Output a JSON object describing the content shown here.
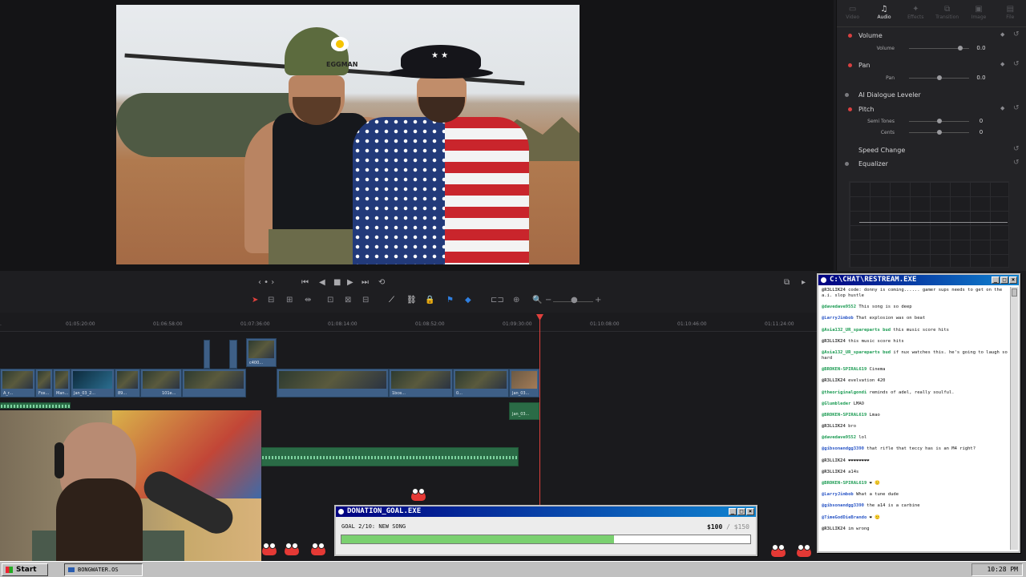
{
  "viewer": {
    "helmet_label": "EGGMAN"
  },
  "inspector": {
    "tabs": [
      {
        "label": "Video",
        "icon": "video-icon"
      },
      {
        "label": "Audio",
        "icon": "music-note-icon"
      },
      {
        "label": "Effects",
        "icon": "effects-icon"
      },
      {
        "label": "Transition",
        "icon": "transition-icon"
      },
      {
        "label": "Image",
        "icon": "image-icon"
      },
      {
        "label": "File",
        "icon": "file-icon"
      }
    ],
    "volume": {
      "title": "Volume",
      "param": "Volume",
      "value": "0.0",
      "level": 0.85
    },
    "pan": {
      "title": "Pan",
      "param": "Pan",
      "value": "0.0",
      "level": 0.5
    },
    "dialogue": {
      "title": "AI Dialogue Leveler"
    },
    "pitch": {
      "title": "Pitch",
      "semi_label": "Semi Tones",
      "semi_value": "0",
      "cents_label": "Cents",
      "cents_value": "0",
      "level": 0.5
    },
    "speed": {
      "title": "Speed Change"
    },
    "eq": {
      "title": "Equalizer"
    }
  },
  "timeline": {
    "ticks": [
      "01:05:20:00",
      "01:06:58:00",
      "01:07:36:00",
      "01:08:14:00",
      "01:08:52:00",
      "01:09:30:00",
      "01:10:08:00",
      "01:10:46:00",
      "01:11:24:00"
    ],
    "clip_labels": [
      "A_r...",
      "Fox...",
      "Man...",
      "Jan_03_2...",
      "89...",
      "101e...",
      "c400...",
      "1bce...",
      "0...",
      "Jan_03...",
      "Jan_03..."
    ]
  },
  "chat": {
    "title": "C:\\CHAT\\RESTREAM.EXE",
    "messages": [
      {
        "user": "@R3LLIK24",
        "text": "code: donny is coming...... gamer sups needs to get on the a.i. slop hustle",
        "color": "#3b3b3b"
      },
      {
        "user": "@davedave9552",
        "text": "This song is so deep",
        "color": "#1b9b52"
      },
      {
        "user": "@LarryJimbob",
        "text": "That explosion was on beat",
        "color": "#2a56c6"
      },
      {
        "user": "@Asia132_UR_spareparts bud",
        "text": "this music score hits",
        "color": "#1b9b52"
      },
      {
        "user": "@R3LLIK24",
        "text": "this music score hits",
        "color": "#3b3b3b"
      },
      {
        "user": "@Asia132_UR_spareparts bud",
        "text": "if nux watches this. he's going to laugh so hard",
        "color": "#1b9b52"
      },
      {
        "user": "@BROKEN-SPIRAL619",
        "text": "Cinema",
        "color": "#1b9b52"
      },
      {
        "user": "@R3LLIK24",
        "text": "evelvation 420",
        "color": "#3b3b3b"
      },
      {
        "user": "@theoriginalgondi",
        "text": "reminds of adel, really soulful.",
        "color": "#1b9b52"
      },
      {
        "user": "@Glumbleder",
        "text": "LMAO",
        "color": "#1b9b52"
      },
      {
        "user": "@BROKEN-SPIRAL619",
        "text": "Lmao",
        "color": "#1b9b52"
      },
      {
        "user": "@R3LLIK24",
        "text": "bro",
        "color": "#3b3b3b"
      },
      {
        "user": "@davedave9552",
        "text": "lol",
        "color": "#1b9b52"
      },
      {
        "user": "@gibsonandgg3390",
        "text": "that rifle that teccy has is an M4 right?",
        "color": "#2a56c6"
      },
      {
        "user": "@R3LLIK24",
        "text": "❤❤❤❤❤❤❤❤",
        "color": "#3b3b3b"
      },
      {
        "user": "@R3LLIK24",
        "text": "a14s",
        "color": "#3b3b3b"
      },
      {
        "user": "@BROKEN-SPIRAL619",
        "text": "❤ 🙂",
        "color": "#1b9b52"
      },
      {
        "user": "@LarryJimbob",
        "text": "What a tune dude",
        "color": "#2a56c6"
      },
      {
        "user": "@gibsonandgg3390",
        "text": "the a14 is a carbine",
        "color": "#2a56c6"
      },
      {
        "user": "@TimeGodDieBrando",
        "text": "❤ 🙂",
        "color": "#2a56c6"
      },
      {
        "user": "@R3LLIK24",
        "text": "im wrong",
        "color": "#3b3b3b"
      }
    ]
  },
  "donation": {
    "title": "DONATION_GOAL.EXE",
    "goal_text": "GOAL 2/10: NEW SONG",
    "raised": "$100",
    "target": "/ $150",
    "progress": 0.667
  },
  "taskbar": {
    "start": "Start",
    "task": "BONGWATER.OS",
    "clock": "10:28 PM"
  },
  "colors": {
    "playhead": "#e0403c",
    "video_clip": "#3e5f86",
    "audio_clip": "#2a6b46",
    "win_title": "#000080"
  }
}
